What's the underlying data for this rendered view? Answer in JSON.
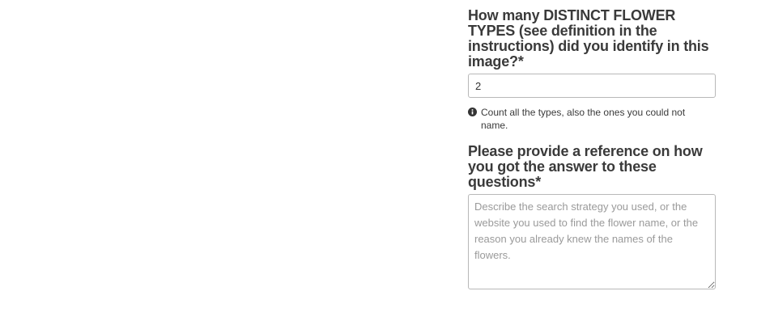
{
  "question1": {
    "label": "How many DISTINCT FLOWER TYPES (see definition in the instructions) did you identify in this image?",
    "required_mark": "*",
    "value": "2",
    "help_icon": "info-circle-icon",
    "help_text": "Count all the types, also the ones you could not name."
  },
  "question2": {
    "label": "Please provide a reference on how you got the answer to these questions",
    "required_mark": "*",
    "value": "",
    "placeholder": "Describe the search strategy you used, or the website you used to find the flower name, or the reason you already knew the names of the flowers."
  }
}
